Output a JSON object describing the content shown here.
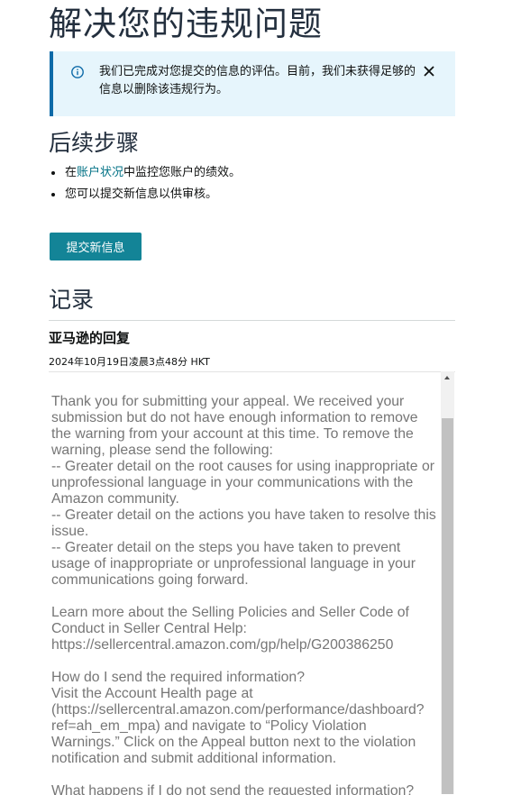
{
  "page": {
    "title": "解决您的违规问题"
  },
  "alert": {
    "icon": "info-icon",
    "message": "我们已完成对您提交的信息的评估。目前，我们未获得足够的信息以删除该违规行为。",
    "close_icon": "close-icon"
  },
  "next_steps": {
    "heading": "后续步骤",
    "items": [
      {
        "prefix": "在",
        "link": "账户状况",
        "suffix": "中监控您账户的绩效。"
      },
      {
        "text": "您可以提交新信息以供审核。"
      }
    ]
  },
  "submit_button": {
    "label": "提交新信息"
  },
  "records": {
    "heading": "记录",
    "reply": {
      "title": "亚马逊的回复",
      "timestamp": "2024年10月19日凌晨3点48分 HKT",
      "body": "Thank you for submitting your appeal. We received your submission but do not have enough information to remove the warning from your account at this time. To remove the warning, please send the following:\n-- Greater detail on the root causes for using inappropriate or unprofessional language in your communications with the Amazon community.\n-- Greater detail on the actions you have taken to resolve this issue.\n-- Greater detail on the steps you have taken to prevent usage of inappropriate or unprofessional language in your communications going forward.\n\nLearn more about the Selling Policies and Seller Code of Conduct in Seller Central Help:\nhttps://sellercentral.amazon.com/gp/help/G200386250\n\nHow do I send the required information?\nVisit the Account Health page at (https://sellercentral.amazon.com/performance/dashboard?ref=ah_em_mpa) and navigate to “Policy Violation Warnings.” Click on the Appeal button next to the violation notification and submit additional information.\n\nWhat happens if I do not send the requested information?"
    }
  },
  "colors": {
    "accent": "#138497",
    "link": "#007185",
    "alert_bg": "#e6f5fc",
    "alert_border": "#0d6aa8"
  }
}
